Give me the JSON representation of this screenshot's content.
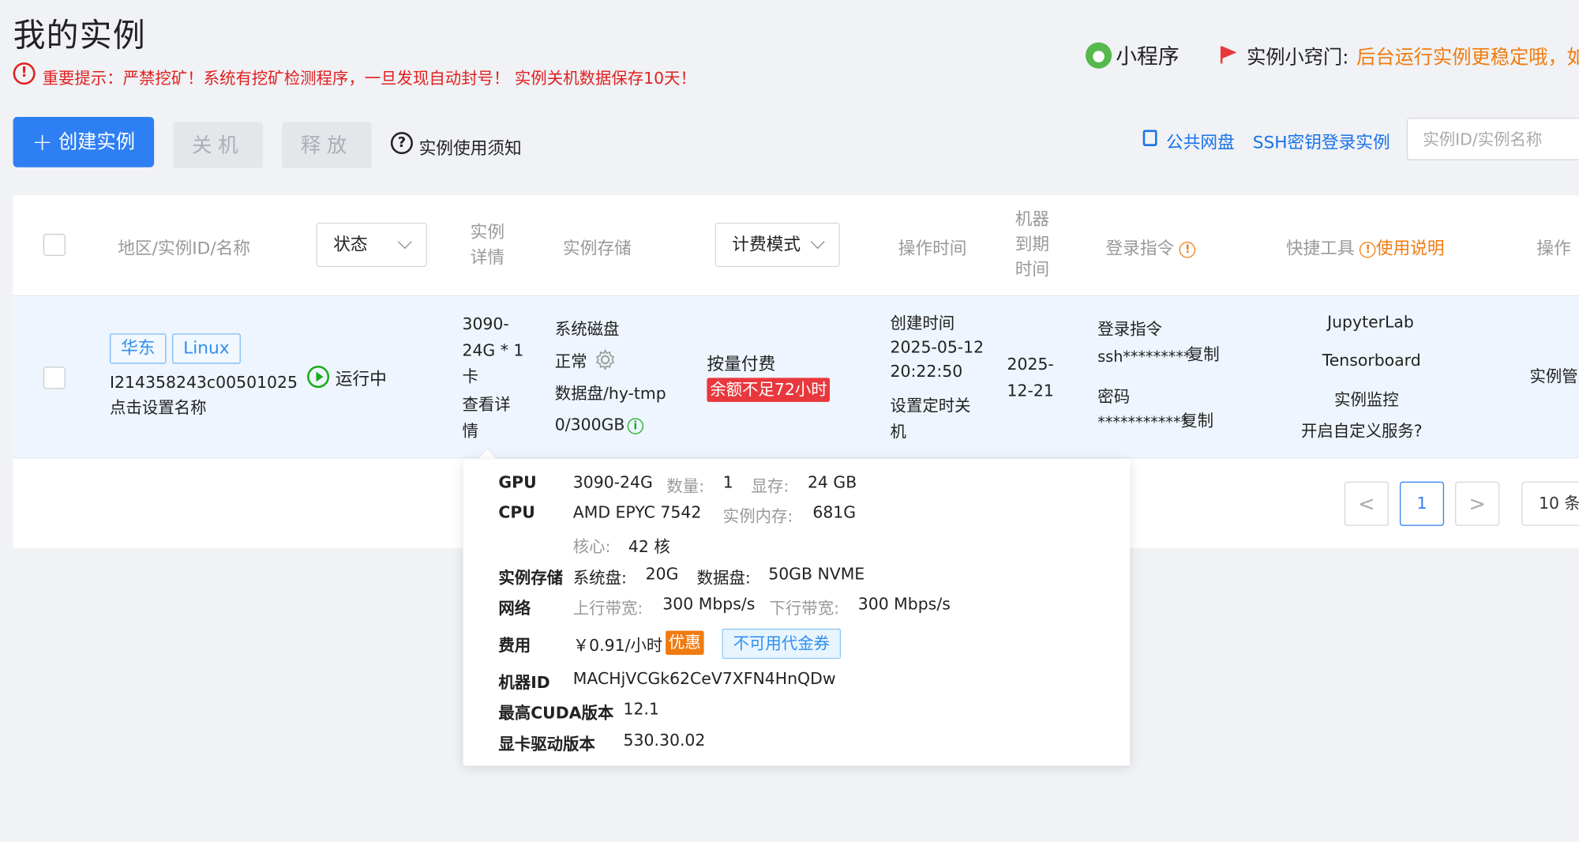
{
  "header": {
    "title": "我的实例",
    "warning": "重要提示：严禁挖矿！系统有挖矿检测程序，一旦发现自动封号！ 实例关机数据保存10天！",
    "mini_program": "小程序",
    "tips_label": "实例小窍门:",
    "tips_text": "后台运行实例更稳定哦，如"
  },
  "toolbar": {
    "create": "创建实例",
    "shutdown": "关机",
    "release": "释放",
    "notice": "实例使用须知",
    "public_disk": "公共网盘",
    "ssh_login": "SSH密钥登录实例",
    "search_placeholder": "实例ID/实例名称"
  },
  "table": {
    "headers": {
      "region": "地区/实例ID/名称",
      "status": "状态",
      "detail": [
        "实例",
        "详情"
      ],
      "storage": "实例存储",
      "billing": "计费模式",
      "op_time": "操作时间",
      "expire": [
        "机器",
        "到期",
        "时间"
      ],
      "login_cmd": "登录指令",
      "tools": "快捷工具",
      "usage": "使用说明",
      "actions": "操作"
    },
    "row": {
      "tag_region": "华东",
      "tag_os": "Linux",
      "instance_id": "I214358243c00501025",
      "set_name": "点击设置名称",
      "status": "运行中",
      "gpu_lines": [
        "3090-",
        "24G * 1",
        "卡"
      ],
      "view_detail": [
        "查看详",
        "情"
      ],
      "sys_disk_label": "系统磁盘",
      "sys_disk_status": "正常",
      "data_disk": "数据盘/hy-tmp",
      "data_disk_usage": "0/300GB",
      "billing": "按量付费",
      "balance_warning": "余额不足72小时",
      "created_label": "创建时间",
      "created_date": "2025-05-12",
      "created_time": "20:22:50",
      "schedule": [
        "设置定时关",
        "机"
      ],
      "expire": [
        "2025-",
        "12-21"
      ],
      "login_label": "登录指令",
      "login_cmd": "ssh*********",
      "copy": "复制",
      "password_label": "密码",
      "password": "************",
      "tools": [
        "JupyterLab",
        "Tensorboard",
        "实例监控",
        "开启自定义服务?"
      ],
      "manage": "实例管"
    }
  },
  "pagination": {
    "prev": "<",
    "current": "1",
    "next": ">",
    "page_size": "10 条"
  },
  "popover": {
    "gpu_key": "GPU",
    "gpu_model": "3090-24G",
    "qty_label": "数量:",
    "qty": "1",
    "vram_label": "显存:",
    "vram": "24 GB",
    "cpu_key": "CPU",
    "cpu_model": "AMD EPYC 7542",
    "mem_label": "实例内存:",
    "mem": "681G",
    "cores_label": "核心:",
    "cores": "42 核",
    "storage_key": "实例存储",
    "sys_disk_label": "系统盘:",
    "sys_disk": "20G",
    "data_disk_label": "数据盘:",
    "data_disk": "50GB NVME",
    "net_key": "网络",
    "up_label": "上行带宽:",
    "up": "300 Mbps/s",
    "down_label": "下行带宽:",
    "down": "300 Mbps/s",
    "fee_key": "费用",
    "fee": "￥0.91/小时",
    "discount": "优惠",
    "coupon": "不可用代金券",
    "machine_key": "机器ID",
    "machine_id": "MACHjVCGk62CeV7XFN4HnQDw",
    "cuda_key": "最高CUDA版本",
    "cuda": "12.1",
    "driver_key": "显卡驱动版本",
    "driver": "530.30.02"
  },
  "colors": {
    "primary": "#2e7ff3",
    "warning_red": "#e02020",
    "tip_orange": "#f07b10",
    "ok_green": "#1aad19",
    "row_bg": "#eef5fe"
  }
}
